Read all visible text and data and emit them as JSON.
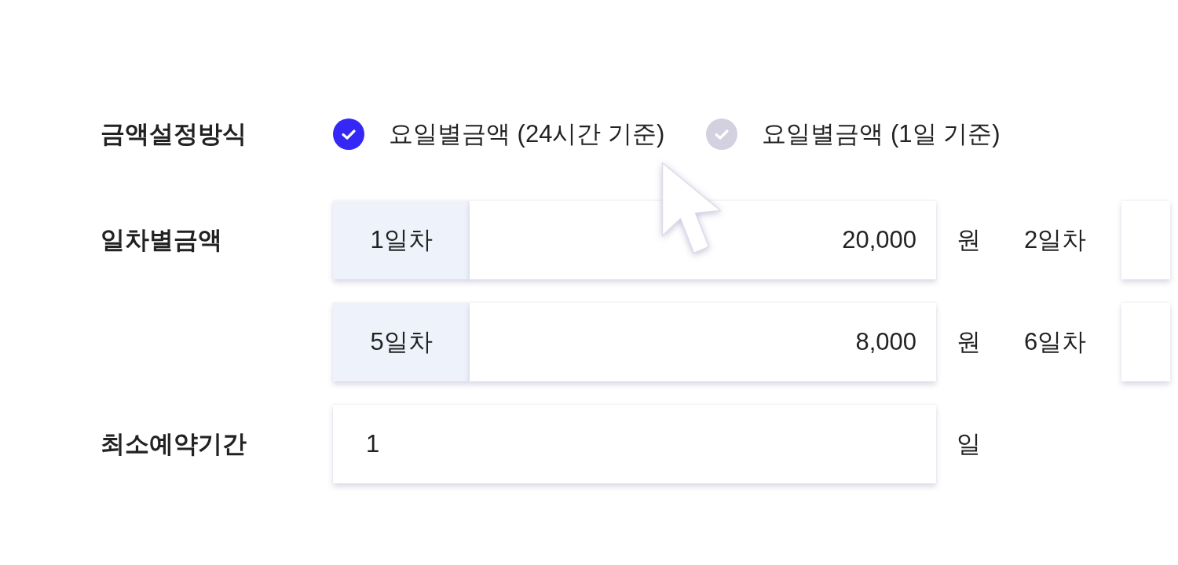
{
  "fields": [
    {
      "kind": "radio",
      "label": "금액설정방식",
      "options": [
        {
          "label": "요일별금액 (24시간 기준)",
          "selected": true
        },
        {
          "label": "요일별금액 (1일 기준)",
          "selected": false
        }
      ]
    },
    {
      "kind": "daily",
      "label": "일차별금액",
      "rows": [
        {
          "items": [
            {
              "kind": "boxed",
              "day": "1일차",
              "value": "20,000",
              "unit": "원"
            },
            {
              "kind": "plain",
              "day": "2일차"
            }
          ]
        },
        {
          "items": [
            {
              "kind": "boxed",
              "day": "5일차",
              "value": "8,000",
              "unit": "원"
            },
            {
              "kind": "plain",
              "day": "6일차"
            }
          ]
        }
      ]
    },
    {
      "kind": "text",
      "label": "최소예약기간",
      "value": "1",
      "unit": "일"
    }
  ]
}
